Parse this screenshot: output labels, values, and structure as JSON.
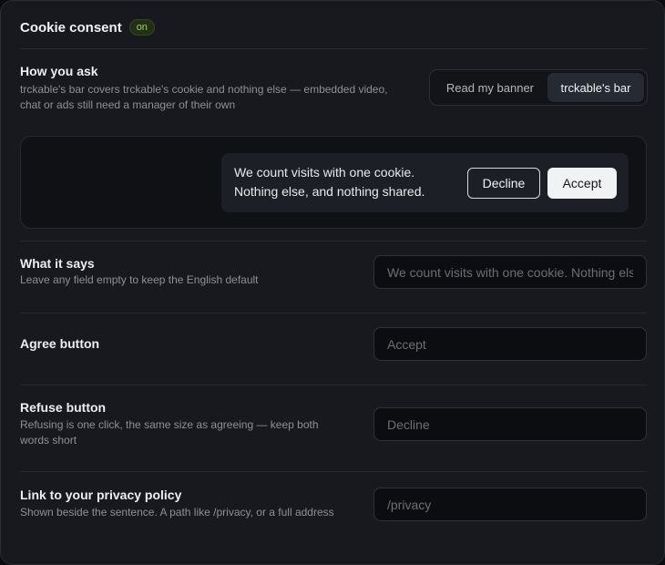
{
  "header": {
    "title": "Cookie consent",
    "badge": "on"
  },
  "how_you_ask": {
    "label": "How you ask",
    "help_line1": "trckable's bar covers trckable's cookie and nothing else — embedded video,",
    "help_line2": "chat or ads still need a manager of their own",
    "options": [
      "Read my banner",
      "trckable's bar"
    ],
    "selected": "trckable's bar"
  },
  "preview": {
    "text_line1": "We count visits with one cookie.",
    "text_line2": "Nothing else, and nothing shared.",
    "decline_label": "Decline",
    "accept_label": "Accept"
  },
  "what_it_says": {
    "label": "What it says",
    "help": "Leave any field empty to keep the English default",
    "placeholder": "We count visits with one cookie. Nothing else, and nothing shared."
  },
  "agree_button": {
    "label": "Agree button",
    "placeholder": "Accept"
  },
  "refuse_button": {
    "label": "Refuse button",
    "help_line1": "Refusing is one click, the same size as agreeing — keep both",
    "help_line2": "words short",
    "placeholder": "Decline"
  },
  "privacy_link": {
    "label": "Link to your privacy policy",
    "help": "Shown beside the sentence. A path like /privacy, or a full address",
    "placeholder": "/privacy"
  }
}
